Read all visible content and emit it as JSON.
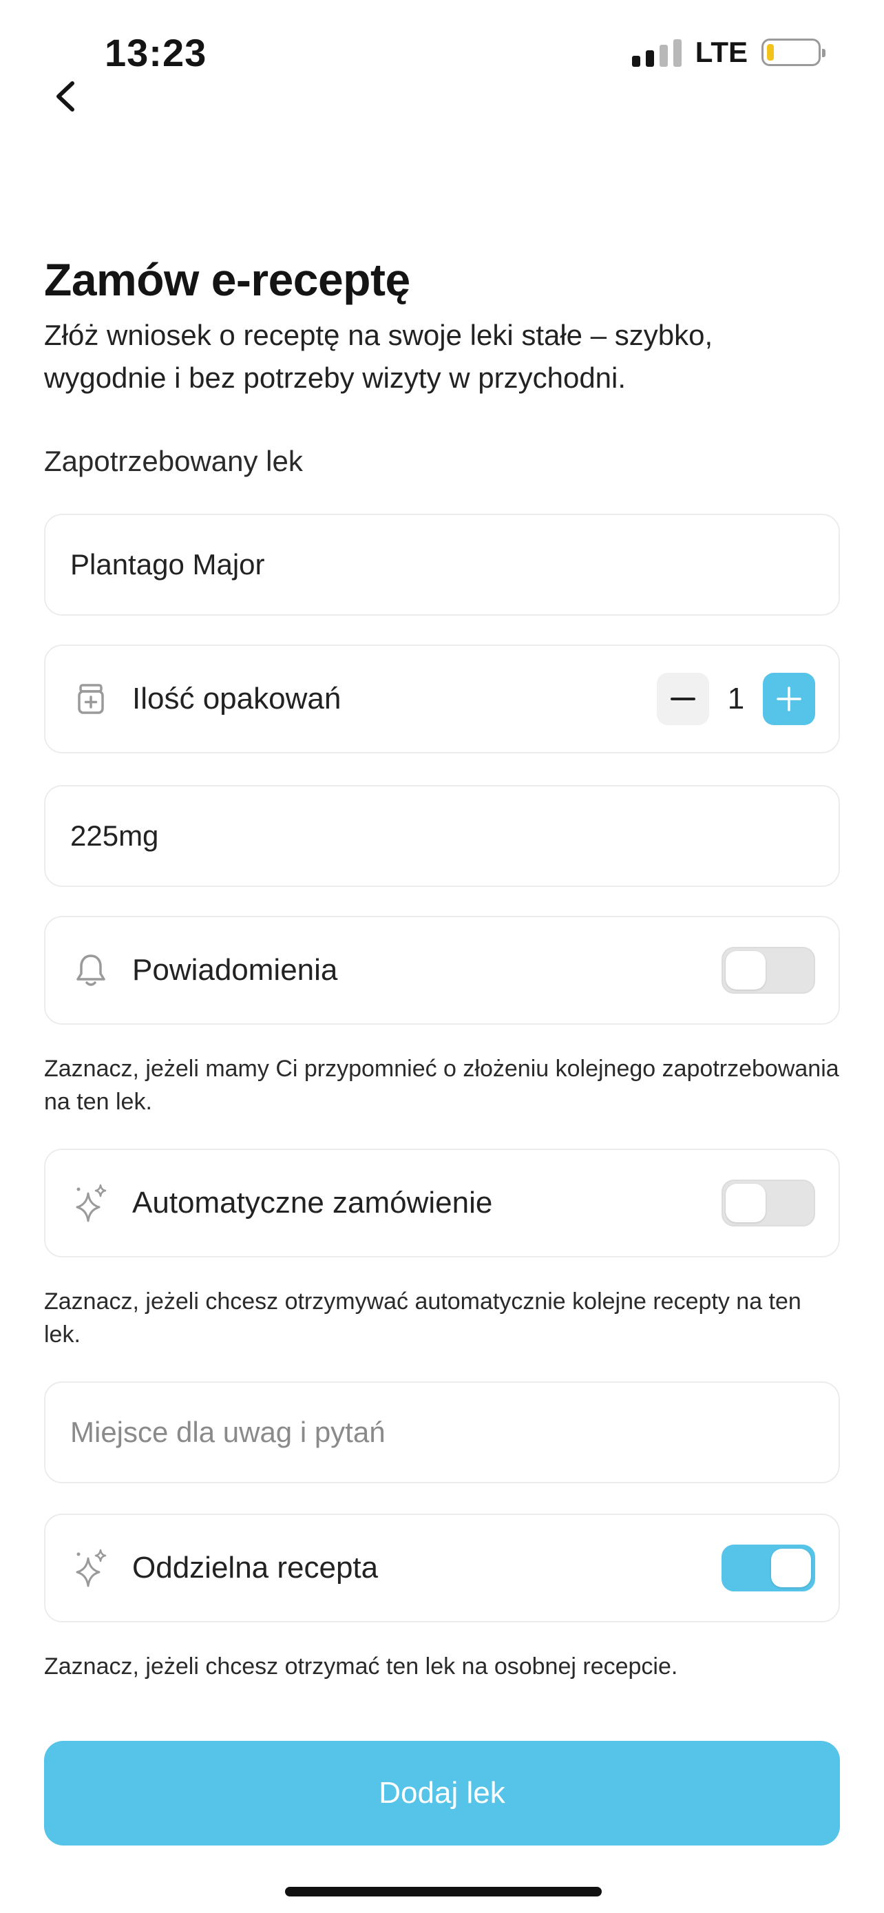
{
  "status_bar": {
    "time": "13:23",
    "network": "LTE"
  },
  "header": {
    "back_icon": "chevron-left-icon"
  },
  "page": {
    "title": "Zamów e-receptę",
    "subtitle": "Złóż wniosek o receptę na swoje leki stałe – szybko, wygodnie i bez potrzeby wizyty w przychodni."
  },
  "form": {
    "section_label": "Zapotrzebowany lek",
    "medicine_name": "Plantago Major",
    "packages": {
      "icon": "medicine-jar-icon",
      "label": "Ilość opakowań",
      "value": "1"
    },
    "dosage": "225mg",
    "notifications": {
      "icon": "bell-icon",
      "label": "Powiadomienia",
      "enabled": false,
      "hint": "Zaznacz, jeżeli mamy Ci przypomnieć o złożeniu kolejnego zapotrzebowania na ten lek."
    },
    "auto_order": {
      "icon": "sparkle-icon",
      "label": "Automatyczne zamówienie",
      "enabled": false,
      "hint": "Zaznacz, jeżeli chcesz otrzymywać automatycznie kolejne recepty na ten lek."
    },
    "notes_placeholder": "Miejsce dla uwag i pytań",
    "separate_prescription": {
      "icon": "sparkle-icon",
      "label": "Oddzielna recepta",
      "enabled": true,
      "hint": "Zaznacz, jeżeli chcesz otrzymać ten lek na osobnej recepcie."
    },
    "submit_label": "Dodaj lek"
  },
  "colors": {
    "accent": "#56c3e8",
    "toggle_off": "#e4e4e4",
    "battery_low": "#f2c31a"
  }
}
